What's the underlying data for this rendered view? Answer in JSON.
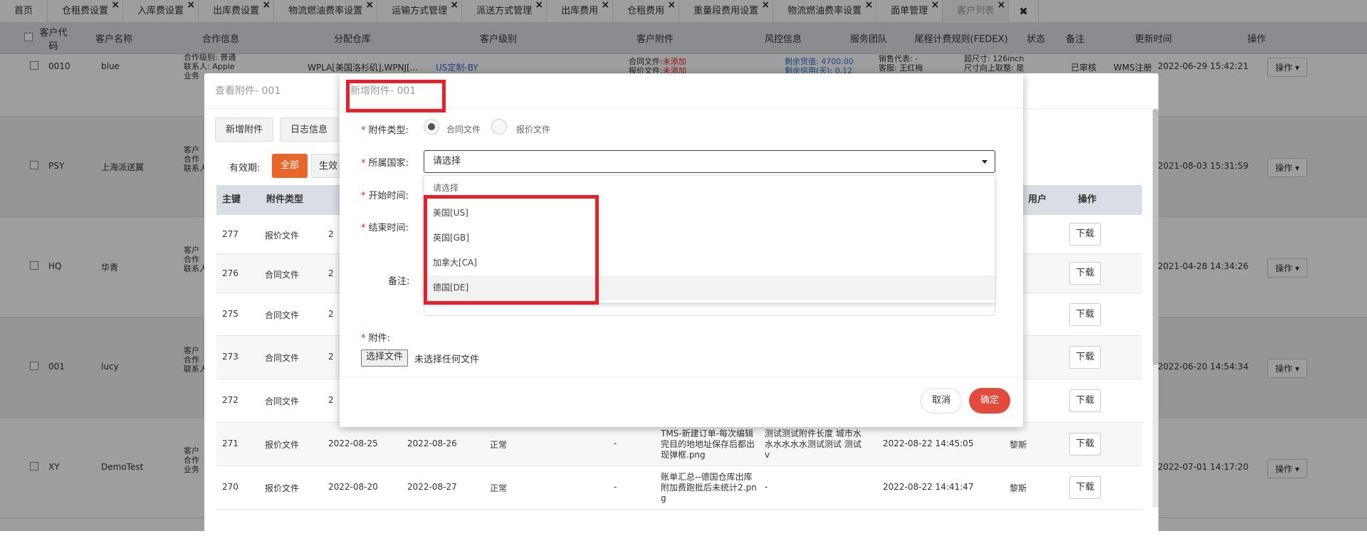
{
  "tabs": [
    {
      "label": "首页",
      "closable": false
    },
    {
      "label": "仓租费设置",
      "closable": true
    },
    {
      "label": "入库费设置",
      "closable": true
    },
    {
      "label": "出库费设置",
      "closable": true
    },
    {
      "label": "物流燃油费率设置",
      "closable": true
    },
    {
      "label": "运输方式管理",
      "closable": true
    },
    {
      "label": "派送方式管理",
      "closable": true
    },
    {
      "label": "出库费用",
      "closable": true
    },
    {
      "label": "仓租费用",
      "closable": true
    },
    {
      "label": "重量段费用设置",
      "closable": true
    },
    {
      "label": "物流燃油费率设置",
      "closable": true
    },
    {
      "label": "面单管理",
      "closable": true
    },
    {
      "label": "客户列表",
      "closable": true,
      "active": true
    }
  ],
  "close_all": "✖",
  "customer_table": {
    "headers": [
      "客户代码",
      "客户名称",
      "合作信息",
      "分配仓库",
      "客户级别",
      "客户附件",
      "风控信息",
      "服务团队",
      "尾程计费规则(FEDEX)",
      "状态",
      "备注",
      "更新时间",
      "操作"
    ],
    "rows": [
      {
        "code": "0010",
        "name": "blue",
        "coop": "合作级别: 普通",
        "coop2": "联系人: Apple",
        "coop3": "业务",
        "warehouse": "WPLA[美国洛杉矶],WPNJ[...",
        "level": "US定制-BY",
        "attach1_label": "合同文件:",
        "attach1_val": "未添加",
        "attach2_label": "报价文件:",
        "attach2_val": "未添加",
        "risk1": "剩余货值: 4700.00",
        "risk2": "剩余信用(天): 0.12",
        "team1": "销售代表: -",
        "team2": "客服: 王红梅",
        "rule1": "超尺寸: 126inch",
        "rule2": "尺寸向上取整: 是",
        "status": "已审核",
        "remark": "WMS注册",
        "updated": "2022-06-29 15:42:21",
        "op": "操作"
      },
      {
        "code": "PSY",
        "name": "上海派送翼",
        "coop": "客户",
        "coop2": "合作",
        "coop3": "联系人",
        "updated": "2021-08-03 15:31:59",
        "op": "操作"
      },
      {
        "code": "HQ",
        "name": "华青",
        "coop": "客户",
        "coop2": "合作",
        "coop3": "联系人",
        "updated": "2021-04-28 14:34:26",
        "op": "操作"
      },
      {
        "code": "001",
        "name": "lucy",
        "coop": "客户",
        "coop2": "合作",
        "coop3": "联系人",
        "updated": "2022-06-20 14:54:34",
        "op": "操作"
      },
      {
        "code": "XY",
        "name": "DemoTest",
        "coop": "客户",
        "coop2": "合作",
        "coop3": "业务",
        "updated": "2022-07-01 14:17:20",
        "op": "操作"
      }
    ]
  },
  "view_dialog": {
    "title": "查看附件- 001",
    "add_btn": "新增附件",
    "log_btn": "日志信息",
    "filter_label": "有效期:",
    "filter_all": "全部",
    "filter_valid": "生效",
    "headers": {
      "id": "主键",
      "type": "附件类型",
      "user": "用户",
      "op": "操作"
    },
    "rows": [
      {
        "id": "277",
        "type": "报价文件",
        "start": "2",
        "dl": "下载"
      },
      {
        "id": "276",
        "type": "合同文件",
        "start": "2",
        "dl": "下载"
      },
      {
        "id": "275",
        "type": "合同文件",
        "start": "2",
        "dl": "下载"
      },
      {
        "id": "273",
        "type": "合同文件",
        "start": "2",
        "dl": "下载"
      },
      {
        "id": "272",
        "type": "合同文件",
        "start": "2",
        "dl": "下载"
      },
      {
        "id": "271",
        "type": "报价文件",
        "start": "2022-08-25",
        "end": "2022-08-26",
        "status": "正常",
        "dash": "-",
        "file1": "TMS-新建订单-每次编辑",
        "file2": "完目的地地址保存后都出",
        "file3": "现弹框.png",
        "remark1": "测试测试附件长度 城市水",
        "remark2": "水水水水水测试测试 测试",
        "remark3": "v",
        "time": "2022-08-22 14:45:05",
        "user": "黎斯",
        "dl": "下载"
      },
      {
        "id": "270",
        "type": "报价文件",
        "start": "2022-08-20",
        "end": "2022-08-27",
        "status": "正常",
        "dash": "-",
        "file1": "账单汇总--德国仓库出库",
        "file2": "附加费跑批后未统计2.pn",
        "file3": "g",
        "remark1": "-",
        "time": "2022-08-22 14:41:47",
        "user": "黎斯",
        "dl": "下载"
      }
    ]
  },
  "add_dialog": {
    "title": "新增附件- 001",
    "type_label": "附件类型:",
    "type_contract": "合同文件",
    "type_quote": "报价文件",
    "country_label": "所属国家:",
    "country_selected": "请选择",
    "country_options": [
      "请选择",
      "美国[US]",
      "英国[GB]",
      "加拿大[CA]",
      "德国[DE]"
    ],
    "start_label": "开始时间:",
    "end_label": "结束时间:",
    "remark_label": "备注:",
    "file_label": "附件:",
    "file_button": "选择文件",
    "file_status": "未选择任何文件",
    "cancel": "取消",
    "confirm": "确定"
  },
  "colors": {
    "highlight": "#e8202a",
    "confirm": "#e24a3b",
    "filter_all": "#e8662a",
    "link_blue": "#2a6fd6"
  }
}
